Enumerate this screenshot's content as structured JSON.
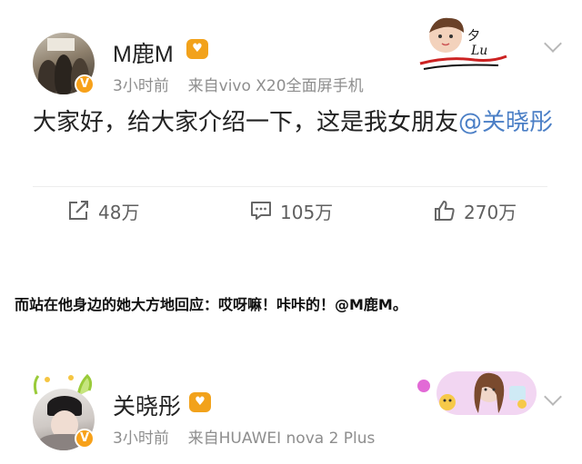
{
  "post1": {
    "username": "M鹿M",
    "time": "3小时前",
    "source": "来自vivo X20全面屏手机",
    "content_prefix": "大家好，给大家介绍一下，这是我女朋友",
    "mention": "@关晓彤",
    "actions": {
      "repost_count": "48万",
      "comment_count": "105万",
      "like_count": "270万"
    }
  },
  "caption": "而站在他身边的她大方地回应：哎呀嘛！咔咔的！@M鹿M。",
  "post2": {
    "username": "关晓彤",
    "time": "3小时前",
    "source": "来自HUAWEI nova 2 Plus"
  },
  "colors": {
    "mention": "#4b7fc6",
    "badge": "#f2a21b",
    "meta_text": "#8e8e8e"
  },
  "icons": [
    "repost-icon",
    "comment-icon",
    "like-icon",
    "chevron-down-icon",
    "verified-badge-icon",
    "vip-badge-icon"
  ]
}
